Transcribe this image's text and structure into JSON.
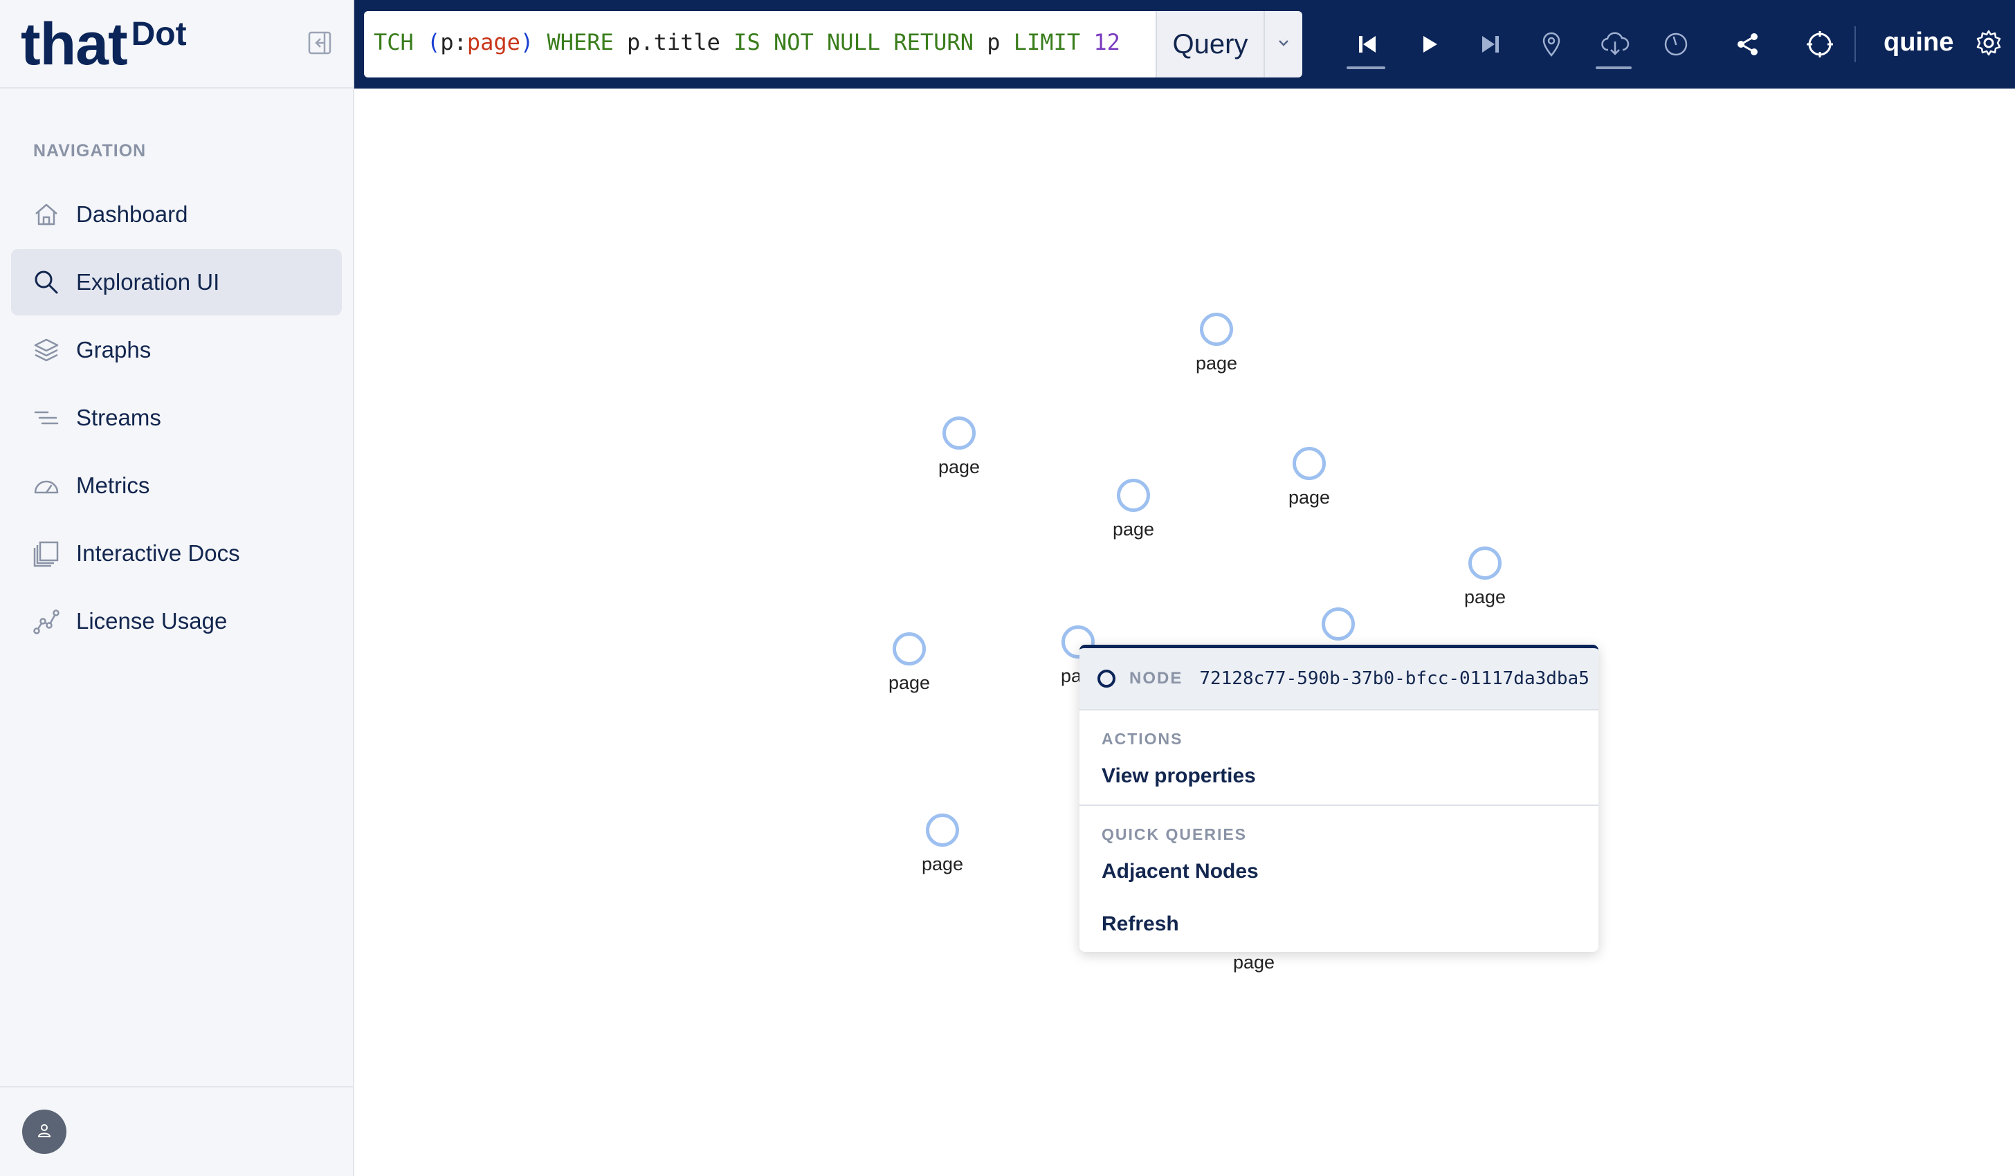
{
  "brand": {
    "name_main": "that",
    "name_sup": "Dot"
  },
  "sidebar": {
    "heading": "NAVIGATION",
    "items": [
      {
        "label": "Dashboard",
        "icon": "home-icon",
        "active": false
      },
      {
        "label": "Exploration UI",
        "icon": "search-icon",
        "active": true
      },
      {
        "label": "Graphs",
        "icon": "layers-icon",
        "active": false
      },
      {
        "label": "Streams",
        "icon": "streams-icon",
        "active": false
      },
      {
        "label": "Metrics",
        "icon": "gauge-icon",
        "active": false
      },
      {
        "label": "Interactive Docs",
        "icon": "docs-icon",
        "active": false
      },
      {
        "label": "License Usage",
        "icon": "chart-line-icon",
        "active": false
      }
    ]
  },
  "query": {
    "tokens": [
      {
        "text": "TCH ",
        "kind": "kw"
      },
      {
        "text": "(",
        "kind": "paren"
      },
      {
        "text": "p",
        "kind": "plain"
      },
      {
        "text": ":",
        "kind": "plain"
      },
      {
        "text": "page",
        "kind": "lbl"
      },
      {
        "text": ")",
        "kind": "paren"
      },
      {
        "text": " WHERE ",
        "kind": "kw"
      },
      {
        "text": "p.title ",
        "kind": "plain"
      },
      {
        "text": "IS NOT NULL RETURN ",
        "kind": "kw"
      },
      {
        "text": "p ",
        "kind": "plain"
      },
      {
        "text": "LIMIT ",
        "kind": "kw"
      },
      {
        "text": "12",
        "kind": "num"
      }
    ],
    "button_label": "Query"
  },
  "toolbar": {
    "icons": [
      "skip-back-icon",
      "play-icon",
      "skip-forward-icon",
      "map-pin-icon",
      "cloud-download-icon",
      "timer-icon",
      "share-icon",
      "crosshair-icon"
    ],
    "user_label": "quine"
  },
  "graph": {
    "nodes": [
      {
        "label": "page"
      },
      {
        "label": "page"
      },
      {
        "label": "page"
      },
      {
        "label": "page"
      },
      {
        "label": "page"
      },
      {
        "label": "page"
      },
      {
        "label": "pa"
      },
      {
        "label": ""
      },
      {
        "label": "page"
      },
      {
        "label": "page"
      }
    ]
  },
  "context_menu": {
    "node_tag": "NODE",
    "node_id": "72128c77-590b-37b0-bfcc-01117da3dba5",
    "actions_heading": "ACTIONS",
    "view_properties": "View properties",
    "quick_queries_heading": "QUICK QUERIES",
    "adjacent_nodes": "Adjacent Nodes",
    "refresh": "Refresh"
  },
  "colors": {
    "navy": "#0b2559",
    "node_ring": "#9dc0f0",
    "active_nav": "#e3e6ee"
  }
}
